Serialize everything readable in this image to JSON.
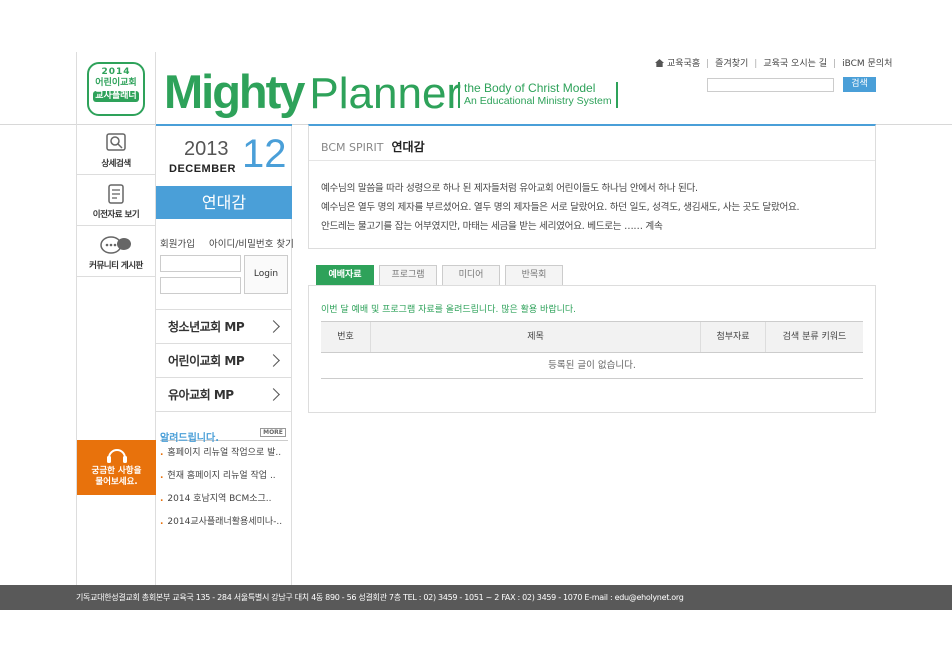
{
  "header": {
    "badge": {
      "year": "2014",
      "line1": "어린이교회",
      "line2": "교사플래너"
    },
    "logo": {
      "mighty": "Mighty",
      "planner": "Planner",
      "sub1": "the Body of Christ Model",
      "sub2": "An Educational Ministry System"
    },
    "top_nav": [
      "교육국홈",
      "즐겨찾기",
      "교육국 오시는 길",
      "iBCM 문의처"
    ],
    "search": {
      "placeholder": "",
      "button": "검색"
    }
  },
  "left_menu": {
    "items": [
      {
        "label": "상세검색",
        "icon": "magnifier-doc-icon"
      },
      {
        "label": "이전자료 보기",
        "icon": "document-list-icon"
      },
      {
        "label": "커뮤니티 게시판",
        "icon": "speech-bubble-icon"
      }
    ],
    "help": {
      "line1": "궁금한 사항을",
      "line2": "물어보세요."
    }
  },
  "date": {
    "year": "2013",
    "month": "DECEMBER",
    "day": "12"
  },
  "theme": "연대감",
  "login": {
    "join": "회원가입",
    "find": "아이디/비밀번호 찾기",
    "button": "Login"
  },
  "mp_menu": [
    "청소년교회 MP",
    "어린이교회 MP",
    "유아교회 MP"
  ],
  "notice": {
    "title": "알려드립니다.",
    "more": "MORE",
    "items": [
      "홈페이지 리뉴얼 작업으로 발..",
      "현재 홈페이지 리뉴얼 작업 ..",
      "2014 호남지역 BCM소그..",
      "2014교사플래너활용세미나-.."
    ]
  },
  "spirit": {
    "label": "BCM SPIRIT",
    "title": "연대감",
    "lines": [
      "예수님의 말씀을 따라 성령으로 하나 된 제자들처럼 유아교회 어린이들도 하나님 안에서 하나 된다.",
      "예수님은 열두 명의 제자를 부르셨어요. 열두 명의 제자들은 서로 달랐어요. 하던 일도, 성격도, 생김새도, 사는 곳도 달랐어요.",
      "안드레는 물고기를 잡는 어부였지만, 마태는 세금을 받는 세리였어요. 베드로는 …… 계속"
    ]
  },
  "tabs": [
    "예배자료",
    "프로그램",
    "미디어",
    "반목회"
  ],
  "content": {
    "desc": "이번 달 예배 및 프로그램 자료를 올려드립니다. 많은 활용 바랍니다.",
    "columns": [
      "번호",
      "제목",
      "첨부자료",
      "검색 분류 키워드"
    ],
    "empty": "등록된 글이 없습니다."
  },
  "footer": "기독교대한성결교회 총회본부 교육국 135 - 284 서울특별시 강남구 대치 4동 890 - 56 성결회관 7층 TEL : 02) 3459 - 1051 ~ 2  FAX : 02) 3459 - 1070  E-mail : edu@eholynet.org",
  "colors": {
    "green": "#2ea25a",
    "blue": "#4a9fd8",
    "orange": "#e8720c",
    "footer": "#595959"
  }
}
